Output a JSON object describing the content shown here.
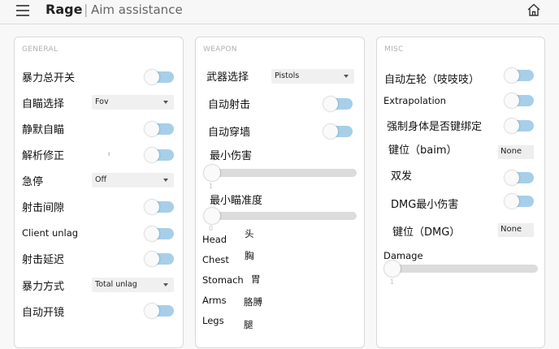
{
  "header": {
    "brand": "Rage",
    "separator": "|",
    "subtitle": "Aim assistance",
    "menu_icon": "hamburger-icon",
    "home_icon": "home-icon"
  },
  "colors": {
    "toggle_track": "#a7cfe9",
    "slider_track": "#dcdcdc",
    "panel_border": "#d9d9d9"
  },
  "general": {
    "title": "GENERAL",
    "items": {
      "rage_switch": "暴力总开关",
      "auto_target": "自瞄选择",
      "auto_target_value": "Fov",
      "silent_aim": "静默自瞄",
      "resolver": "解析修正",
      "resolver_mark": "ı",
      "quick_stop": "急停",
      "quick_stop_value": "Off",
      "shot_delay": "射击间隙",
      "client_unlag": "Client unlag",
      "shot_backtrack": "射击延迟",
      "rage_mode": "暴力方式",
      "rage_mode_value": "Total unlag",
      "auto_scope": "自动开镜"
    }
  },
  "weapon": {
    "title": "WEAPON",
    "weapon_select": "武器选择",
    "weapon_value": "Pistols",
    "auto_fire": "自动射击",
    "auto_wall": "自动穿墙",
    "min_damage": "最小伤害",
    "min_damage_value": "1",
    "min_hitchance": "最小瞄准度",
    "min_hitchance_value": "0",
    "hitboxes": {
      "head_en": "Head",
      "head_cn": "头",
      "chest_en": "Chest",
      "chest_cn": "胸",
      "stomach_en": "Stomach",
      "stomach_cn": "胃",
      "arms_en": "Arms",
      "arms_cn": "胳膊",
      "legs_en": "Legs",
      "legs_cn": "腿"
    }
  },
  "misc": {
    "title": "MISC",
    "auto_peek": "自动左轮（吱吱吱）",
    "extrapolation": "Extrapolation",
    "force_body": "强制身体是否键绑定",
    "key_baim": "键位（baim）",
    "key_baim_value": "None",
    "double_tap": "双发",
    "dmg_min": "DMG最小伤害",
    "key_dmg": "键位（DMG）",
    "key_dmg_value": "None",
    "damage": "Damage",
    "damage_value": "1"
  }
}
